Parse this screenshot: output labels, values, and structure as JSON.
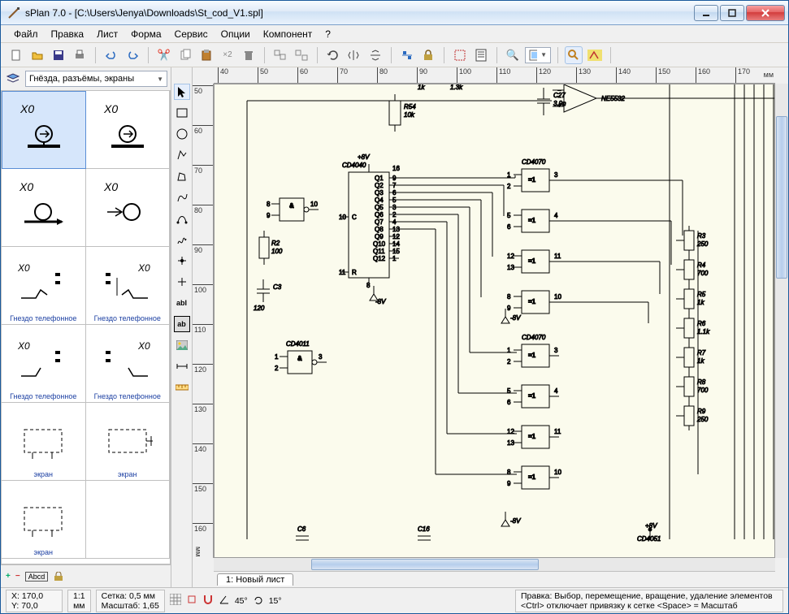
{
  "window": {
    "title": "sPlan 7.0 - [C:\\Users\\Jenya\\Downloads\\St_cod_V1.spl]"
  },
  "menu": [
    "Файл",
    "Правка",
    "Лист",
    "Форма",
    "Сервис",
    "Опции",
    "Компонент",
    "?"
  ],
  "sidebar": {
    "library": "Гнёзда, разъёмы, экраны",
    "cells": [
      {
        "top": "X0",
        "caption": ""
      },
      {
        "top": "X0",
        "caption": ""
      },
      {
        "top": "X0",
        "caption": ""
      },
      {
        "top": "X0",
        "caption": ""
      },
      {
        "top": "X0",
        "caption": "Гнездо телефонное"
      },
      {
        "top": "X0",
        "caption": "Гнездо телефонное"
      },
      {
        "top": "X0",
        "caption": "Гнездо телефонное"
      },
      {
        "top": "X0",
        "caption": "Гнездо телефонное"
      },
      {
        "top": "",
        "caption": "экран"
      },
      {
        "top": "",
        "caption": "экран"
      },
      {
        "top": "",
        "caption": "экран"
      }
    ]
  },
  "rulers": {
    "h": [
      "40",
      "50",
      "60",
      "70",
      "80",
      "90",
      "100",
      "110",
      "120",
      "130",
      "140",
      "150",
      "160",
      "170"
    ],
    "h_unit": "мм",
    "v": [
      "50",
      "60",
      "70",
      "80",
      "90",
      "100",
      "110",
      "120",
      "130",
      "140",
      "150",
      "160"
    ],
    "v_unit": "мм"
  },
  "tabs": {
    "label": "1: Новый лист"
  },
  "status": {
    "coord_x": "X: 170,0",
    "coord_y": "Y: 70,0",
    "ratio_top": "1:1",
    "ratio_bot": "мм",
    "grid": "Сетка: 0,5 мм",
    "zoom": "Масштаб:  1,65",
    "angle1": "45°",
    "angle2": "15°",
    "help1": "Правка: Выбор, перемещение, вращение, удаление элементов",
    "help2": "<Ctrl> отключает привязку к сетке <Space> = Масштаб"
  },
  "schematic": {
    "chips": {
      "cd4040": "CD4040",
      "cd4011": "CD4011",
      "cd4070": "CD4070",
      "cd4051": "CD4051",
      "ne5532": "NE5532"
    },
    "parts": {
      "r54": {
        "ref": "R54",
        "val": "10k"
      },
      "r2": {
        "ref": "R2",
        "val": "100"
      },
      "c3": {
        "ref": "C3",
        "val": "120"
      },
      "c27": {
        "ref": "C27",
        "val": "3.9n"
      },
      "c6": {
        "ref": "C6"
      },
      "c16": {
        "ref": "C16"
      },
      "r3": {
        "ref": "R3",
        "val": "250"
      },
      "r4": {
        "ref": "R4",
        "val": "700"
      },
      "r5": {
        "ref": "R5",
        "val": "1k"
      },
      "r6": {
        "ref": "R6",
        "val": "1.1k"
      },
      "r7": {
        "ref": "R7",
        "val": "1k"
      },
      "r8": {
        "ref": "R8",
        "val": "700"
      },
      "r9": {
        "ref": "R9",
        "val": "250"
      }
    },
    "rails": {
      "p8v": "+8V",
      "n8v": "-8V",
      "p8v2": "+8V"
    },
    "top_labels": {
      "r1k": "1k",
      "r1_3k": "1.3k"
    },
    "gate": {
      "and": "&",
      "xor": "=1"
    },
    "pins": {
      "and1": [
        "8",
        "9",
        "10"
      ],
      "and2": [
        "1",
        "2",
        "3"
      ],
      "cd4040": [
        "16",
        "9",
        "7",
        "6",
        "5",
        "3",
        "2",
        "4",
        "13",
        "12",
        "14",
        "15",
        "1",
        "11",
        "8",
        "10",
        "Q1",
        "Q2",
        "Q3",
        "Q4",
        "Q5",
        "Q6",
        "Q7",
        "Q8",
        "Q9",
        "Q10",
        "Q11",
        "Q12",
        "C",
        "R"
      ],
      "xor_pairs": [
        [
          "1",
          "2",
          "3"
        ],
        [
          "5",
          "6",
          "4"
        ],
        [
          "12",
          "13",
          "11"
        ],
        [
          "8",
          "9",
          "10"
        ]
      ]
    }
  },
  "bottombar_icons": {
    "plus": "+",
    "abcd": "Abcd"
  }
}
